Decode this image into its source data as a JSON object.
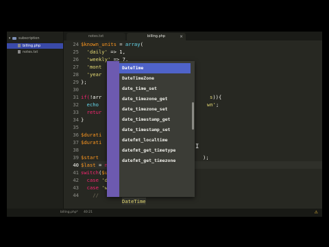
{
  "sidebar": {
    "folder": "subscription",
    "files": [
      {
        "name": "billing.php",
        "selected": true
      },
      {
        "name": "notes.txt",
        "selected": false
      }
    ]
  },
  "tabs": [
    {
      "label": "notes.txt",
      "active": false
    },
    {
      "label": "billing.php",
      "active": true
    }
  ],
  "editor": {
    "current_line": 40,
    "line_numbers": [
      "24",
      "25",
      "26",
      "27",
      "28",
      "29",
      "30",
      "31",
      "32",
      "33",
      "34",
      "35",
      "36",
      "37",
      "38",
      "39",
      "40",
      "41",
      "42",
      "43",
      "44"
    ],
    "visible_code": {
      "l24_var": "$known_units",
      "l24_eq": " = ",
      "l24_fn": "array",
      "l24_rest": "(",
      "l25_str": "'daily'",
      "l25_rest": " => 1,",
      "l26_str": "'weekly'",
      "l26_rest": " => 7,",
      "l27": "'mont",
      "l28": "'year",
      "l29": "};",
      "l31_kw": "if(",
      "l31_rest": "!arr",
      "l31_tail_str": "s",
      "l31_tail": ")){",
      "l32_fn": "echo",
      "l32_tail_str": "wn'",
      "l32_tail": ";",
      "l33_kw": "retur",
      "l34": "}",
      "l36_var": "$durati",
      "l37_var": "$durati",
      "l39_var": "$start",
      "l39_tail": ");",
      "l40_var": "$last",
      "l40_eq": " = ",
      "l40_kw": "new ",
      "l41_kw": "switch",
      "l41_var": "$unit",
      "l41_rest": "){",
      "l42_kw": "case ",
      "l42_str": "'daily'",
      "l42_rest": ":",
      "l43_kw": "case ",
      "l43_str": "'weekly'",
      "l43_rest": ":",
      "l44_comment": "//"
    },
    "typed_ghost": "DateTime"
  },
  "autocomplete": {
    "items": [
      "DateTime",
      "DateTimeZone",
      "date_time_set",
      "date_timezone_get",
      "date_timezone_set",
      "date_timestamp_get",
      "date_timestamp_set",
      "datefmt_localtime",
      "datefmt_get_timetype",
      "datefmt_get_timezone"
    ],
    "selected_index": 0
  },
  "status": {
    "file": "billing.php*",
    "position": "40:21",
    "warning_icon": "warning-icon"
  },
  "colors": {
    "background": "#272822",
    "selection": "#4f63c9",
    "popup_stripe": "#6d5ab0"
  }
}
